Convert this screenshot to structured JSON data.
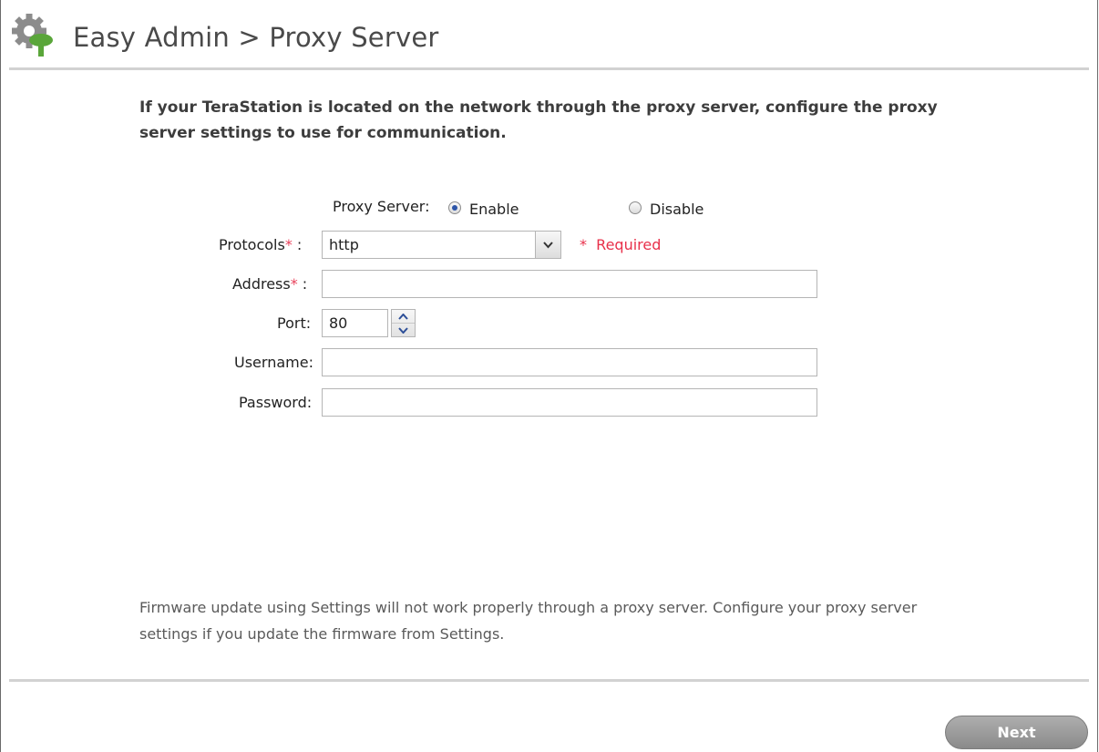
{
  "header": {
    "title": "Easy Admin > Proxy Server",
    "icon": "gear-tree-icon"
  },
  "intro": {
    "text": "If your TeraStation is located on the network through the proxy server, configure the proxy server settings to use for communication."
  },
  "form": {
    "proxy_server_label": "Proxy Server:",
    "enable_label": "Enable",
    "disable_label": "Disable",
    "proxy_enabled": true,
    "protocols_label": "Protocols",
    "protocols_value": "http",
    "required_note": "Required",
    "required_star": "*",
    "address_label": "Address",
    "address_value": "",
    "port_label": "Port:",
    "port_value": "80",
    "username_label": "Username:",
    "username_value": "",
    "password_label": "Password:",
    "password_value": ""
  },
  "footer_note": {
    "text": "Firmware update using Settings will not work properly through a proxy server. Configure your proxy server settings if you update the firmware from Settings."
  },
  "buttons": {
    "next_label": "Next"
  },
  "colors": {
    "accent_green": "#5aa63a",
    "required_red": "#e8304a",
    "radio_blue": "#2d55a8"
  }
}
